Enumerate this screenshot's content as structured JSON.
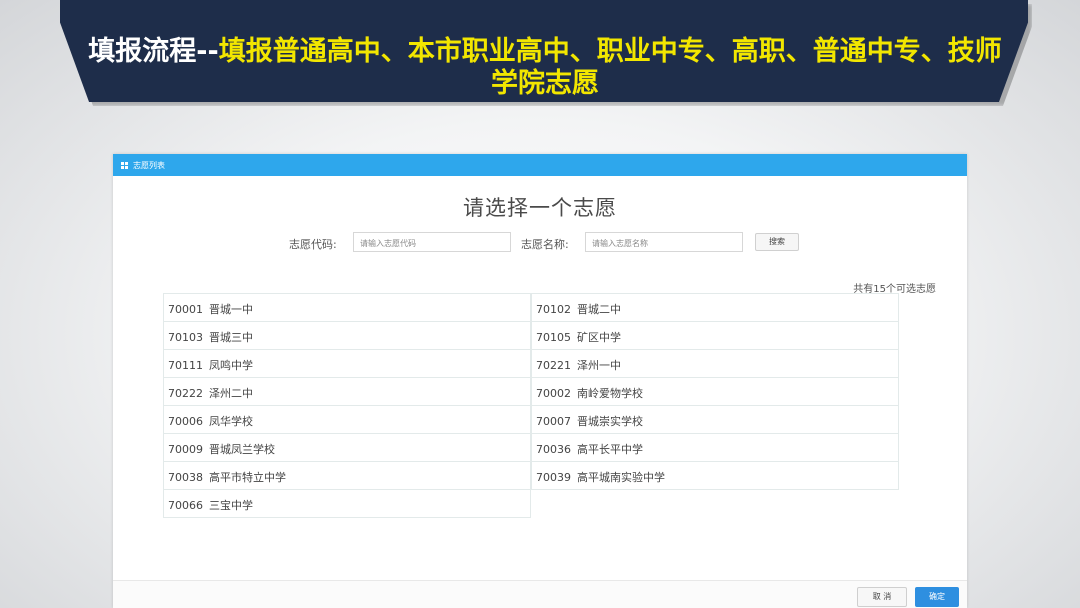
{
  "slide": {
    "title_prefix": "填报流程--",
    "title_rest": "填报普通高中、本市职业高中、职业中专、高职、普通中专、技师学院志愿"
  },
  "dialog": {
    "tab_label": "志愿列表",
    "heading": "请选择一个志愿",
    "code_label": "志愿代码:",
    "code_placeholder": "请输入志愿代码",
    "name_label": "志愿名称:",
    "name_placeholder": "请输入志愿名称",
    "search_button": "搜索",
    "count_text": "共有15个可选志愿",
    "cancel_button": "取 消",
    "ok_button": "确定"
  },
  "options": [
    {
      "code": "70001",
      "name": "晋城一中"
    },
    {
      "code": "70102",
      "name": "晋城二中"
    },
    {
      "code": "70103",
      "name": "晋城三中"
    },
    {
      "code": "70105",
      "name": "矿区中学"
    },
    {
      "code": "70111",
      "name": "凤鸣中学"
    },
    {
      "code": "70221",
      "name": "泽州一中"
    },
    {
      "code": "70222",
      "name": "泽州二中"
    },
    {
      "code": "70002",
      "name": "南岭爱物学校"
    },
    {
      "code": "70006",
      "name": "凤华学校"
    },
    {
      "code": "70007",
      "name": "晋城崇实学校"
    },
    {
      "code": "70009",
      "name": "晋城凤兰学校"
    },
    {
      "code": "70036",
      "name": "高平长平中学"
    },
    {
      "code": "70038",
      "name": "高平市特立中学"
    },
    {
      "code": "70039",
      "name": "高平城南实验中学"
    },
    {
      "code": "70066",
      "name": "三宝中学"
    }
  ],
  "colors": {
    "banner": "#1e2d4a",
    "title_yellow": "#f2e600",
    "titlebar": "#2ea7ec",
    "ok_button": "#2e8fe0"
  }
}
